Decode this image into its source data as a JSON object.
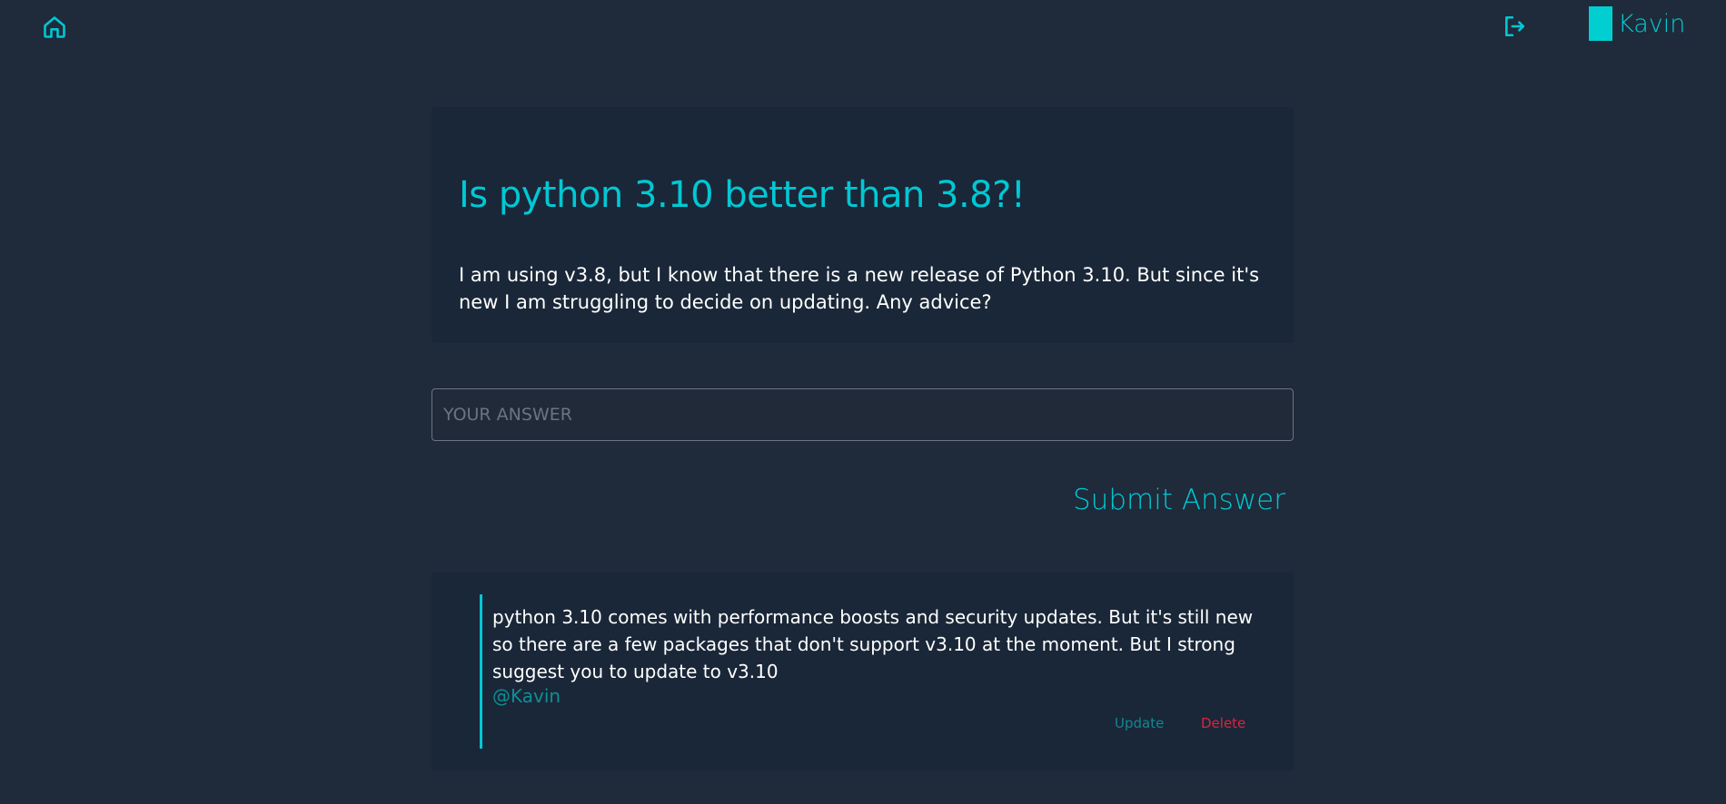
{
  "header": {
    "home_icon": "home-icon",
    "logout_icon": "logout-icon",
    "username": "Kavin",
    "accent_color": "#00ced1"
  },
  "question": {
    "title": "Is python 3.10 better than 3.8?!",
    "body": "I am using v3.8, but I know that there is a new release of Python 3.10. But since it's new I am struggling to decide on updating. Any advice?"
  },
  "answer_form": {
    "placeholder": "YOUR ANSWER",
    "value": "",
    "submit_label": "Submit Answer"
  },
  "answers": [
    {
      "text": "python 3.10 comes with performance boosts and security updates. But it's still new so there are a few packages that don't support v3.10 at the moment. But I strong suggest you to update to v3.10",
      "author": "@Kavin",
      "update_label": "Update",
      "delete_label": "Delete",
      "delete_color": "#e0213b"
    }
  ]
}
